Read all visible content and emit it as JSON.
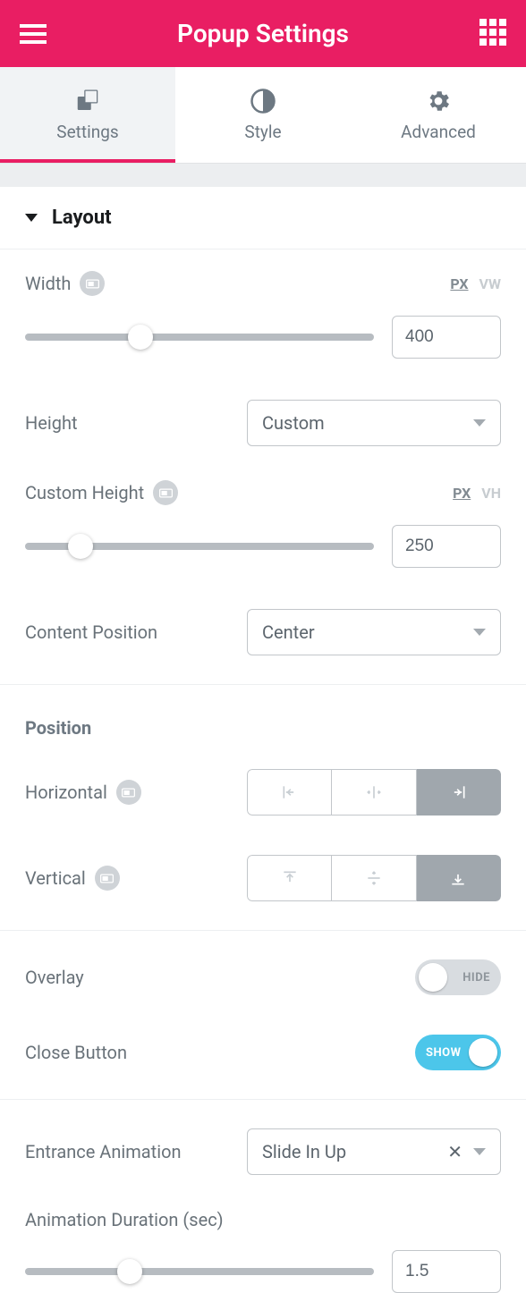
{
  "header": {
    "title": "Popup Settings"
  },
  "tabs": {
    "settings": "Settings",
    "style": "Style",
    "advanced": "Advanced"
  },
  "section": {
    "layout": "Layout"
  },
  "layout": {
    "width_label": "Width",
    "width_units": {
      "px": "PX",
      "vw": "VW"
    },
    "width_value": "400",
    "height_label": "Height",
    "height_select": "Custom",
    "custom_height_label": "Custom Height",
    "custom_height_units": {
      "px": "PX",
      "vh": "VH"
    },
    "custom_height_value": "250",
    "content_position_label": "Content Position",
    "content_position_select": "Center"
  },
  "position": {
    "heading": "Position",
    "horizontal_label": "Horizontal",
    "vertical_label": "Vertical"
  },
  "toggles": {
    "overlay_label": "Overlay",
    "overlay_state": "HIDE",
    "close_label": "Close Button",
    "close_state": "SHOW"
  },
  "anim": {
    "entrance_label": "Entrance Animation",
    "entrance_value": "Slide In Up",
    "duration_label": "Animation Duration (sec)",
    "duration_value": "1.5"
  }
}
